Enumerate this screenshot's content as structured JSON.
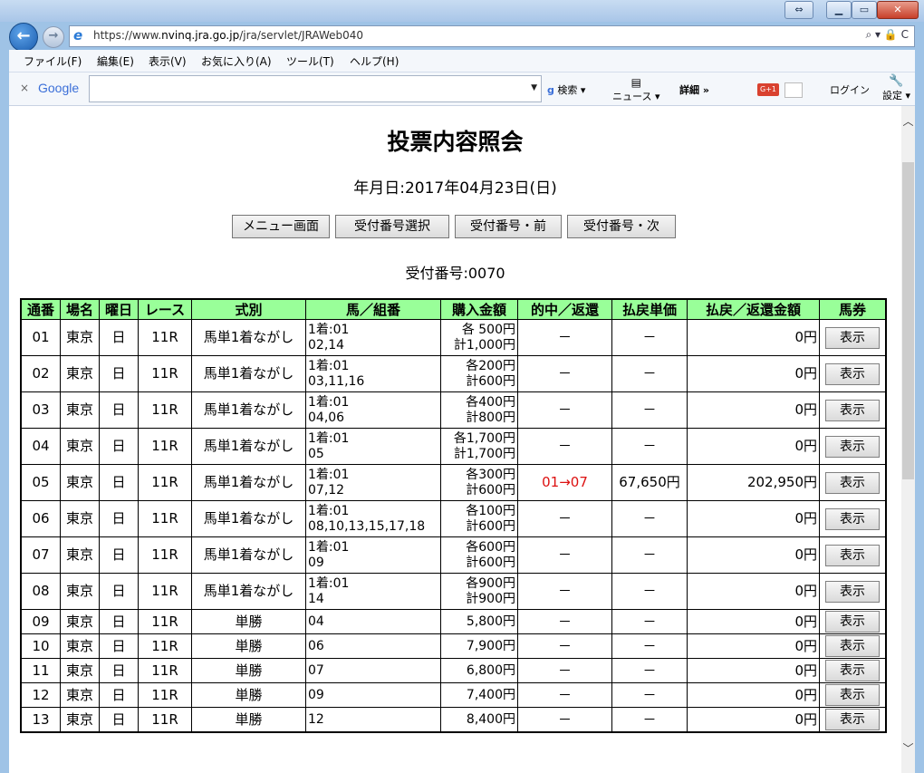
{
  "browser": {
    "url_prefix": "https://www.",
    "url_domain": "nvinq.jra.go.jp",
    "url_path": "/jra/servlet/JRAWeb040",
    "addr_tools": "⌕ ▾ 🔒 C",
    "menus": [
      "ファイル(F)",
      "編集(E)",
      "表示(V)",
      "お気に入り(A)",
      "ツール(T)",
      "ヘルプ(H)"
    ],
    "gtoolbar": {
      "close": "×",
      "logo": "Google",
      "search_btn": "検索",
      "news": "ニュース",
      "details": "詳細 »",
      "gplus": "G+1",
      "login": "ログイン",
      "settings": "設定"
    }
  },
  "page": {
    "title": "投票内容照会",
    "date_line": "年月日:2017年04月23日(日)",
    "buttons": [
      "メニュー画面",
      "受付番号選択",
      "受付番号・前",
      "受付番号・次"
    ],
    "ticket_line": "受付番号:0070"
  },
  "table": {
    "headers": [
      "通番",
      "場名",
      "曜日",
      "レース",
      "式別",
      "馬／組番",
      "購入金額",
      "的中／返還",
      "払戻単価",
      "払戻／返還金額",
      "馬券"
    ],
    "rows": [
      {
        "no": "01",
        "place": "東京",
        "day": "日",
        "race": "11R",
        "type": "馬単1着ながし",
        "combo1": "1着:01",
        "combo2": "02,14",
        "amt1": "各 500円",
        "amt2": "計1,000円",
        "hit": "－",
        "unit": "－",
        "payout": "0円",
        "btn": "表示"
      },
      {
        "no": "02",
        "place": "東京",
        "day": "日",
        "race": "11R",
        "type": "馬単1着ながし",
        "combo1": "1着:01",
        "combo2": "03,11,16",
        "amt1": "各200円",
        "amt2": "計600円",
        "hit": "－",
        "unit": "－",
        "payout": "0円",
        "btn": "表示"
      },
      {
        "no": "03",
        "place": "東京",
        "day": "日",
        "race": "11R",
        "type": "馬単1着ながし",
        "combo1": "1着:01",
        "combo2": "04,06",
        "amt1": "各400円",
        "amt2": "計800円",
        "hit": "－",
        "unit": "－",
        "payout": "0円",
        "btn": "表示"
      },
      {
        "no": "04",
        "place": "東京",
        "day": "日",
        "race": "11R",
        "type": "馬単1着ながし",
        "combo1": "1着:01",
        "combo2": "05",
        "amt1": "各1,700円",
        "amt2": "計1,700円",
        "hit": "－",
        "unit": "－",
        "payout": "0円",
        "btn": "表示"
      },
      {
        "no": "05",
        "place": "東京",
        "day": "日",
        "race": "11R",
        "type": "馬単1着ながし",
        "combo1": "1着:01",
        "combo2": "07,12",
        "amt1": "各300円",
        "amt2": "計600円",
        "hit": "01→07",
        "unit": "67,650円",
        "payout": "202,950円",
        "btn": "表示",
        "hit_red": true
      },
      {
        "no": "06",
        "place": "東京",
        "day": "日",
        "race": "11R",
        "type": "馬単1着ながし",
        "combo1": "1着:01",
        "combo2": "08,10,13,15,17,18",
        "amt1": "各100円",
        "amt2": "計600円",
        "hit": "－",
        "unit": "－",
        "payout": "0円",
        "btn": "表示"
      },
      {
        "no": "07",
        "place": "東京",
        "day": "日",
        "race": "11R",
        "type": "馬単1着ながし",
        "combo1": "1着:01",
        "combo2": "09",
        "amt1": "各600円",
        "amt2": "計600円",
        "hit": "－",
        "unit": "－",
        "payout": "0円",
        "btn": "表示"
      },
      {
        "no": "08",
        "place": "東京",
        "day": "日",
        "race": "11R",
        "type": "馬単1着ながし",
        "combo1": "1着:01",
        "combo2": "14",
        "amt1": "各900円",
        "amt2": "計900円",
        "hit": "－",
        "unit": "－",
        "payout": "0円",
        "btn": "表示"
      },
      {
        "no": "09",
        "place": "東京",
        "day": "日",
        "race": "11R",
        "type": "単勝",
        "combo1": "04",
        "combo2": "",
        "amt1": "5,800円",
        "amt2": "",
        "hit": "－",
        "unit": "－",
        "payout": "0円",
        "btn": "表示"
      },
      {
        "no": "10",
        "place": "東京",
        "day": "日",
        "race": "11R",
        "type": "単勝",
        "combo1": "06",
        "combo2": "",
        "amt1": "7,900円",
        "amt2": "",
        "hit": "－",
        "unit": "－",
        "payout": "0円",
        "btn": "表示"
      },
      {
        "no": "11",
        "place": "東京",
        "day": "日",
        "race": "11R",
        "type": "単勝",
        "combo1": "07",
        "combo2": "",
        "amt1": "6,800円",
        "amt2": "",
        "hit": "－",
        "unit": "－",
        "payout": "0円",
        "btn": "表示"
      },
      {
        "no": "12",
        "place": "東京",
        "day": "日",
        "race": "11R",
        "type": "単勝",
        "combo1": "09",
        "combo2": "",
        "amt1": "7,400円",
        "amt2": "",
        "hit": "－",
        "unit": "－",
        "payout": "0円",
        "btn": "表示"
      },
      {
        "no": "13",
        "place": "東京",
        "day": "日",
        "race": "11R",
        "type": "単勝",
        "combo1": "12",
        "combo2": "",
        "amt1": "8,400円",
        "amt2": "",
        "hit": "－",
        "unit": "－",
        "payout": "0円",
        "btn": "表示"
      }
    ]
  },
  "colors": {
    "header_bg": "#99ff99",
    "hit_red": "#dd1111"
  }
}
